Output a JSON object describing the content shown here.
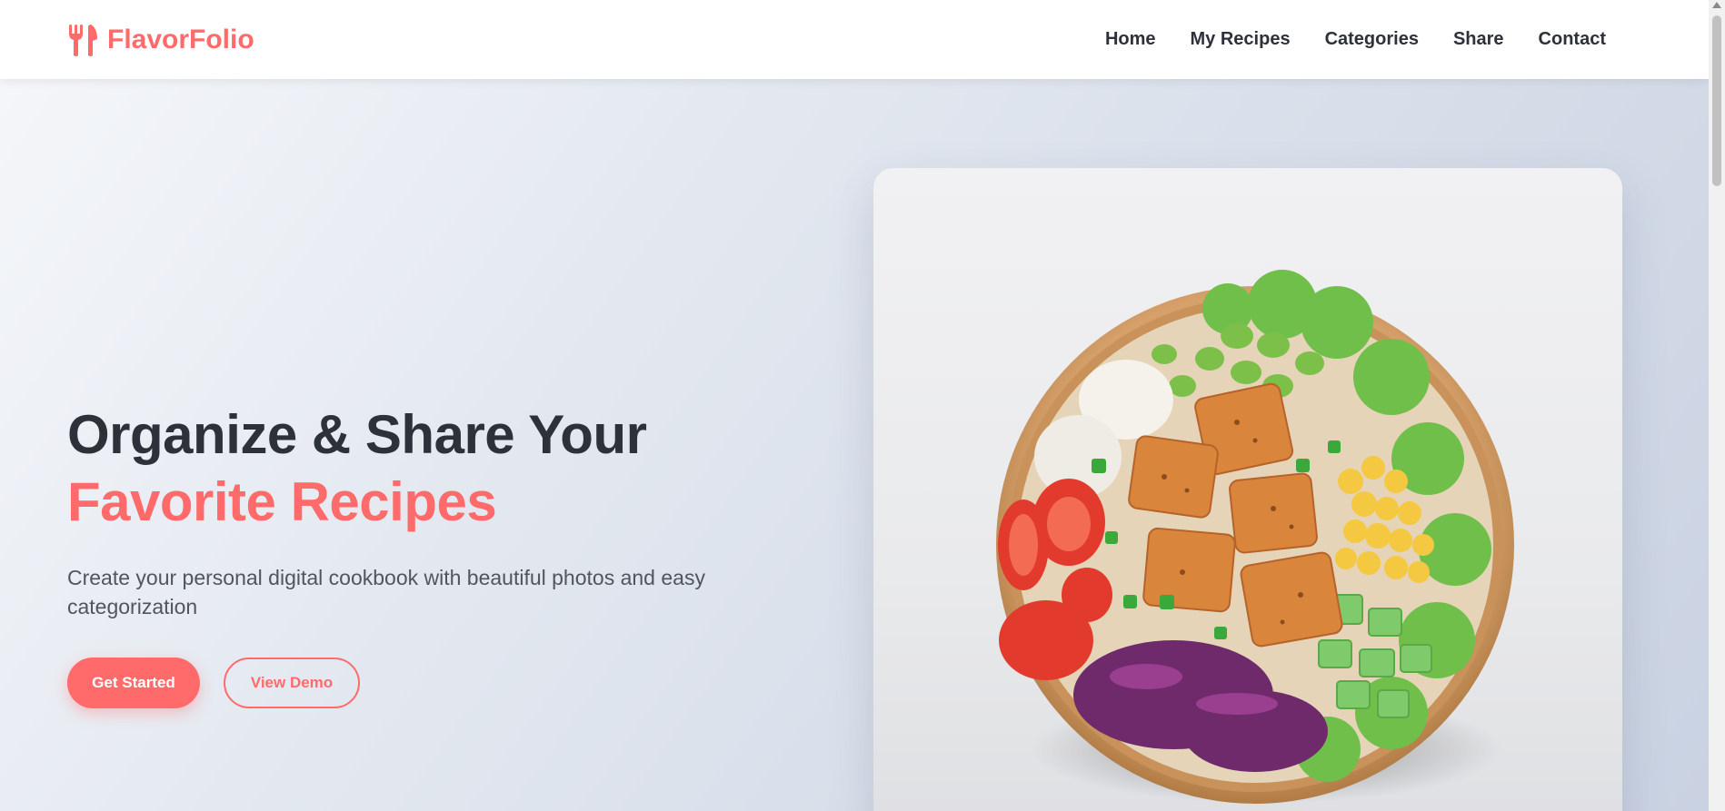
{
  "brand": {
    "name": "FlavorFolio",
    "icon": "utensils-icon",
    "color": "#ff6b6b"
  },
  "nav": {
    "items": [
      {
        "label": "Home"
      },
      {
        "label": "My Recipes"
      },
      {
        "label": "Categories"
      },
      {
        "label": "Share"
      },
      {
        "label": "Contact"
      }
    ]
  },
  "hero": {
    "title_line1": "Organize & Share Your",
    "title_line2": "Favorite Recipes",
    "subtitle": "Create your personal digital cookbook with beautiful photos and easy categorization",
    "primary_button": "Get Started",
    "secondary_button": "View Demo",
    "image_subject": "salad-bowl-photo"
  },
  "colors": {
    "accent": "#ff6b6b",
    "text_dark": "#2d3139",
    "text_muted": "#50555e"
  }
}
